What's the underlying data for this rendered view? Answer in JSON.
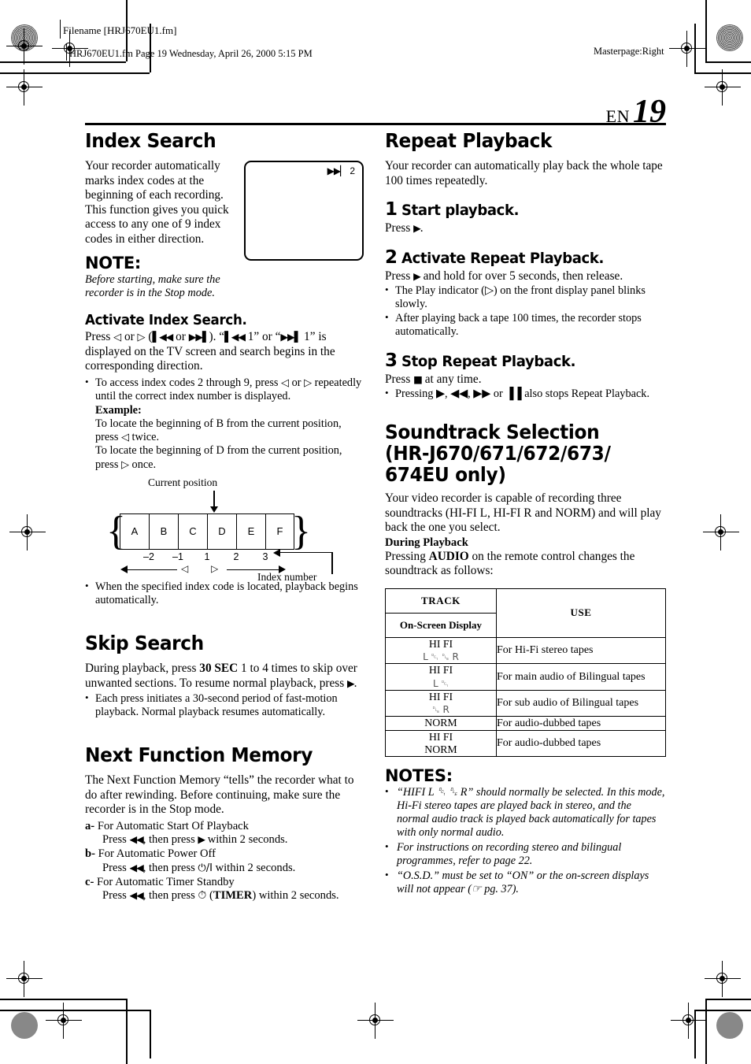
{
  "slug": {
    "filename": "Filename [HRJ670EU1.fm]",
    "file_line": "HRJ670EU1.fm  Page 19  Wednesday, April 26, 2000  5:15 PM",
    "masterpage": "Masterpage:Right"
  },
  "page": {
    "lang": "EN",
    "number": "19"
  },
  "left": {
    "index_search": {
      "heading": "Index Search",
      "intro": "Your recorder automatically marks index codes at the beginning of each recording. This function gives you quick access to any one of 9 index codes in either direction.",
      "note_heading": "NOTE:",
      "note_body": "Before starting, make sure the recorder is in the Stop mode.",
      "tv_osd_symbol": "▶▶▏",
      "tv_osd_number": "2",
      "activate_heading": "Activate Index Search.",
      "activate_line1_a": "Press ",
      "activate_line1_b": " or ",
      "activate_line1_c": " (",
      "activate_line1_d": " or ",
      "activate_line1_e": "). “",
      "activate_line1_f": " 1” or “",
      "activate_line1_g": " 1” is displayed on the TV screen and search begins in the corresponding direction.",
      "bullet1_a": "To access index codes 2 through 9, press ",
      "bullet1_b": " or ",
      "bullet1_c": " repeatedly until the correct index number is displayed.",
      "example_label": "Example:",
      "example_line1_a": "To locate the beginning of B from the current position, press ",
      "example_line1_b": " twice.",
      "example_line2_a": "To locate the beginning of D from the current position, press ",
      "example_line2_b": " once.",
      "bullet2": "When the specified index code is located, playback begins automatically."
    },
    "tape_diagram": {
      "current_position_label": "Current position",
      "index_number_label": "Index number",
      "cells": [
        "A",
        "B",
        "C",
        "D",
        "E",
        "F"
      ],
      "numbers": [
        "–2",
        "–1",
        "1",
        "2",
        "3"
      ]
    },
    "skip_search": {
      "heading": "Skip Search",
      "body_a": "During playback, press ",
      "body_key": "30 SEC",
      "body_b": " 1 to 4 times to skip over unwanted sections. To resume normal playback, press ",
      "body_c": ".",
      "bullet": "Each press initiates a 30-second period of fast-motion playback. Normal playback resumes automatically."
    },
    "next_function": {
      "heading": "Next Function Memory",
      "intro": "The Next Function Memory “tells” the recorder what to do after rewinding. Before continuing, make sure the recorder is in the Stop mode.",
      "items": [
        {
          "label": "a-",
          "title": "For Automatic Start Of Playback",
          "press_a": "Press ",
          "press_sym1": "◀◀",
          "press_b": ", then press ",
          "press_sym2": "▶",
          "press_c": " within 2 seconds."
        },
        {
          "label": "b-",
          "title": "For Automatic Power Off",
          "press_a": "Press ",
          "press_sym1": "◀◀",
          "press_b": ", then press ",
          "press_sym2": "⏻/I",
          "press_c": " within 2 seconds."
        },
        {
          "label": "c-",
          "title": "For Automatic Timer Standby",
          "press_a": "Press ",
          "press_sym1": "◀◀",
          "press_b": ", then press ",
          "press_sym2": "◷",
          "press_c": " (TIMER) within 2 seconds."
        }
      ]
    }
  },
  "right": {
    "repeat_playback": {
      "heading": "Repeat Playback",
      "intro": "Your recorder can automatically play back the whole tape 100 times repeatedly.",
      "steps": [
        {
          "n": "1",
          "title": "Start playback.",
          "line_a": "Press ",
          "line_sym": "▶",
          "line_b": ".",
          "bullets": []
        },
        {
          "n": "2",
          "title": "Activate Repeat Playback.",
          "line_a": "Press ",
          "line_sym": "▶",
          "line_b": " and hold for over 5 seconds, then release.",
          "bullets": [
            "The Play indicator (▷) on the front display panel blinks slowly.",
            "After playing back a tape 100 times, the recorder stops automatically."
          ]
        },
        {
          "n": "3",
          "title": "Stop Repeat Playback.",
          "line_a": "Press ",
          "line_sym": "■",
          "line_b": " at any time.",
          "bullets": [
            "Pressing ▶, ◀◀, ▶▶ or ▐▐ also stops Repeat Playback."
          ]
        }
      ]
    },
    "soundtrack": {
      "heading_line1": "Soundtrack Selection",
      "heading_line2": "(HR-J670/671/672/673/",
      "heading_line3": "674EU only)",
      "intro": "Your video recorder is capable of recording three soundtracks (HI-FI L, HI-FI R and NORM) and will play back the one you select.",
      "during_heading": "During Playback",
      "during_a": "Pressing ",
      "during_key": "AUDIO",
      "during_b": " on the remote control changes the soundtrack as follows:",
      "table": {
        "header_track": "TRACK",
        "header_osd": "On-Screen Display",
        "header_use": "USE",
        "rows": [
          {
            "track_line1": "HI FI",
            "track_line2": "L ␑ ␐ R",
            "use": "For Hi-Fi stereo tapes"
          },
          {
            "track_line1": "HI FI",
            "track_line2": "L ␑",
            "use": "For main audio of Bilingual tapes"
          },
          {
            "track_line1": "HI FI",
            "track_line2": "␐ R",
            "use": "For sub audio of Bilingual tapes"
          },
          {
            "track_line1": "NORM",
            "track_line2": "",
            "use": "For audio-dubbed tapes"
          },
          {
            "track_line1": "HI FI",
            "track_line2": "NORM",
            "use": "For audio-dubbed tapes"
          }
        ]
      }
    },
    "notes": {
      "heading": "NOTES:",
      "items": [
        "“HIFI L ␑ ␐ R” should normally be selected. In this mode, Hi-Fi stereo tapes are played back in stereo, and the normal audio track is played back automatically for tapes with only normal audio.",
        "For instructions on recording stereo and bilingual programmes, refer to page 22.",
        "“O.S.D.” must be set to “ON” or the on-screen displays will not appear (☞ pg. 37)."
      ]
    }
  }
}
